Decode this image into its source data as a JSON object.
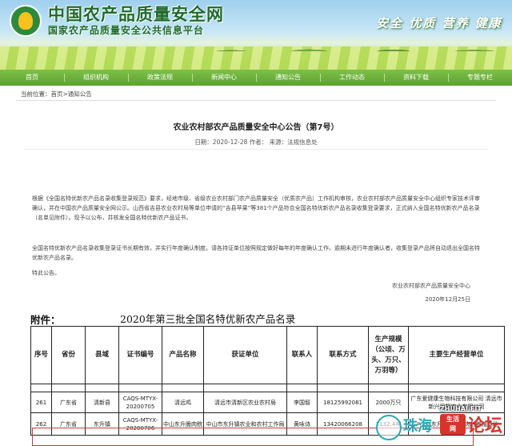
{
  "header": {
    "site_title": "中国农产品质量安全网",
    "site_subtitle": "国家农产品质量安全公共信息平台",
    "slogan": "安全 优质 营养 健康"
  },
  "nav": {
    "items": [
      {
        "label": "首页"
      },
      {
        "label": "组织机构"
      },
      {
        "label": "政策法规"
      },
      {
        "label": "新闻中心"
      },
      {
        "label": "通知公告"
      },
      {
        "label": "工作动态"
      },
      {
        "label": "资料下载"
      },
      {
        "label": "专题专栏"
      }
    ]
  },
  "breadcrumb": {
    "prefix": "当前位置：",
    "home": "首页",
    "sep1": ">",
    "section": "通知公告"
  },
  "article": {
    "title": "农业农村部农产品质量安全中心公告（第7号）",
    "meta": "日期：2020-12-28  作者：  来源：法规信息处",
    "para1": "根据《全国名特优新农产品名录收集登录规范》要求，经地市级、省级农业农村部门农产品质量安全（优质农产品）工作机构审核，农业农村部农产品质量安全中心组织专家技术评审确认，并在中国农产品质量安全网公示。山西省吉县农业农村局等单位申请的“吉县苹果”等381个产品符合全国名特优新农产品名录收集登录要求，正式纳入全国名特优新农产品名录（名单见附件）。现予以公布，并核发全国名特优新农产品证书。",
    "para2": "全国名特优新农产品名录收集登录证书长期有效，并实行年度确认制度。请各持证单位按照规定做好每年的年度确认工作。逾期未进行年度确认者，收集登录产品将自动退出全国名特优新农产品名录。",
    "para3": "特此公告。",
    "sign_org": "农业农村部农产品质量安全中心",
    "sign_date": "2020年12月25日"
  },
  "attachment": {
    "label": "附件：",
    "title": "2020年第三批全国名特优新农产品名录",
    "columns": [
      "序号",
      "省份",
      "县域",
      "证书编号",
      "产品名称",
      "获证单位",
      "联系人",
      "联系方式",
      "生产规模（公顷、万头、万只、万羽等）",
      "主要生产经营单位"
    ],
    "rows": [
      [
        "261",
        "广东省",
        "清新县",
        "CAQS-MTYX-20200705",
        "清远鸡",
        "清远市清新区农业农村局",
        "李国智",
        "18125992081",
        "2000万只",
        "广东爱健康生物科技有限公司 清远市新兴凤翔农业有限公司"
      ],
      [
        "262",
        "广东省",
        "东升镇",
        "CAQS-MTYX-20200706",
        "中山东升脆肉鲩",
        "中山市东升镇农业和农村工作局",
        "黄咏诗",
        "13420066208",
        "1132.4吨",
        "中山市东升镇年仟脆肉鲩养殖基地"
      ]
    ]
  },
  "watermark": {
    "url": "ZHUHAI.FIT",
    "text": "珠海",
    "tag_line1": "生活",
    "tag_line2": "网",
    "big": "论坛"
  }
}
